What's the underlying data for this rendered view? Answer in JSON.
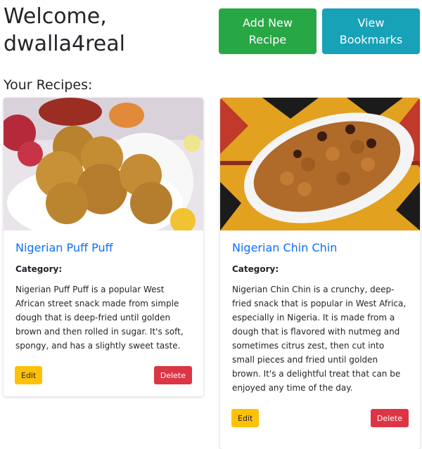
{
  "header": {
    "welcome": "Welcome, dwalla4real",
    "add_recipe": "Add New Recipe",
    "view_bookmarks": "View Bookmarks"
  },
  "section_title": "Your Recipes:",
  "recipes": [
    {
      "title": "Nigerian Puff Puff",
      "category_label": "Category:",
      "description": "Nigerian Puff Puff is a popular West African street snack made from simple dough that is deep-fried until golden brown and then rolled in sugar. It's soft, spongy, and has a slightly sweet taste.",
      "edit": "Edit",
      "delete": "Delete"
    },
    {
      "title": "Nigerian Chin Chin",
      "category_label": "Category:",
      "description": "Nigerian Chin Chin is a crunchy, deep-fried snack that is popular in West Africa, especially in Nigeria. It is made from a dough that is flavored with nutmeg and sometimes citrus zest, then cut into small pieces and fried until golden brown. It's a delightful treat that can be enjoyed any time of the day.",
      "edit": "Edit",
      "delete": "Delete"
    }
  ],
  "colors": {
    "success": "#28a745",
    "info": "#17a2b8",
    "warning": "#ffc107",
    "danger": "#dc3545",
    "link": "#0d6efd"
  }
}
